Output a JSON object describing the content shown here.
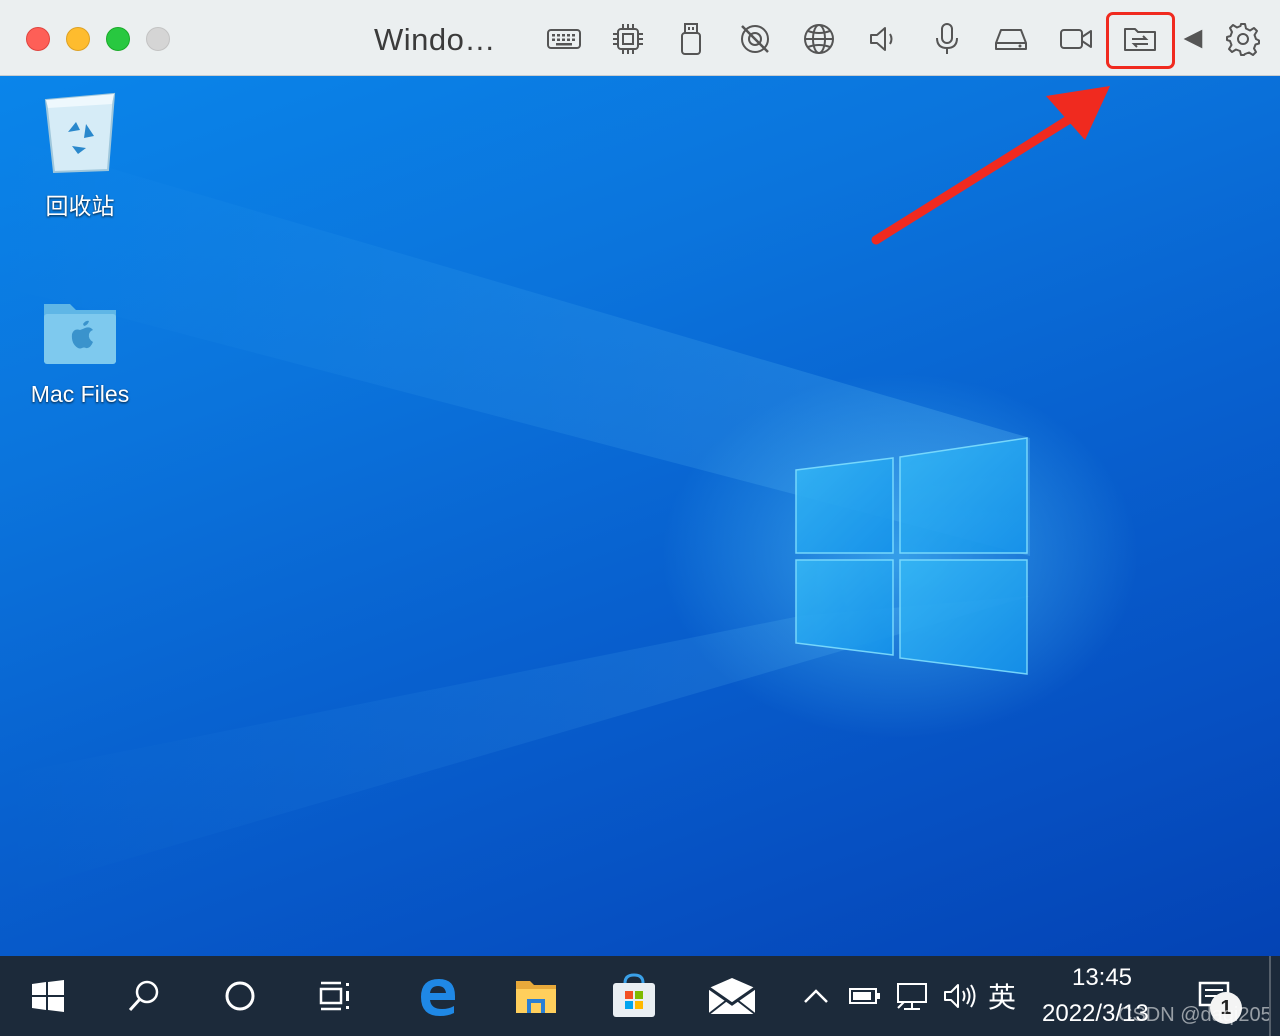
{
  "window": {
    "title": "Windo…",
    "traffic_lights": [
      "close",
      "minimize",
      "zoom",
      "disabled"
    ]
  },
  "toolbar": {
    "icons": [
      "keyboard-icon",
      "cpu-icon",
      "usb-icon",
      "camera-off-icon",
      "globe-icon",
      "speaker-icon",
      "microphone-icon",
      "hard-drive-icon",
      "video-camera-icon",
      "shared-folder-icon",
      "back-arrow-icon",
      "gear-icon"
    ],
    "highlighted_icon": "shared-folder-icon",
    "highlight_color": "#f02a1f"
  },
  "desktop": {
    "icons": [
      {
        "name": "recycle-bin",
        "label": "回收站"
      },
      {
        "name": "mac-files",
        "label": "Mac Files"
      }
    ],
    "background_color": "#0a6fd8"
  },
  "taskbar": {
    "apps": [
      "start-icon",
      "search-icon",
      "cortana-icon",
      "task-view-icon",
      "edge-icon",
      "file-explorer-icon",
      "store-icon",
      "mail-icon"
    ],
    "tray": {
      "ime": "英",
      "time": "13:45",
      "date": "2022/3/13",
      "notification_count": "1"
    },
    "watermark": "CSDN @daqi205"
  }
}
